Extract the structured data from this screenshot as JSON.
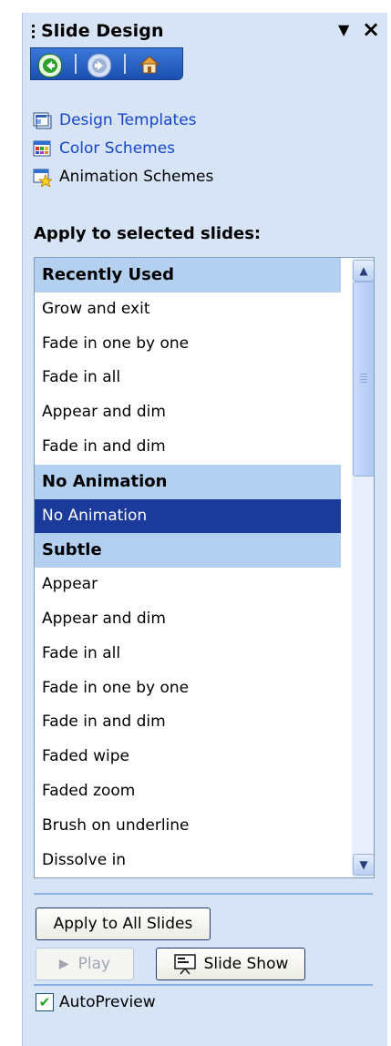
{
  "pane": {
    "title": "Slide Design",
    "dropdown_glyph": "▼",
    "close_glyph": "×"
  },
  "nav": {
    "back_icon": "back-arrow-icon",
    "forward_icon": "forward-arrow-icon",
    "home_icon": "home-icon"
  },
  "links": [
    {
      "label": "Design Templates",
      "icon": "design-templates-icon"
    },
    {
      "label": "Color Schemes",
      "icon": "color-schemes-icon"
    },
    {
      "label": "Animation Schemes",
      "icon": "animation-schemes-icon"
    }
  ],
  "apply_label": "Apply to selected slides:",
  "list": {
    "rows": [
      {
        "text": "Recently Used",
        "kind": "header"
      },
      {
        "text": "Grow and exit",
        "kind": "item"
      },
      {
        "text": "Fade in one by one",
        "kind": "item"
      },
      {
        "text": "Fade in all",
        "kind": "item"
      },
      {
        "text": "Appear and dim",
        "kind": "item"
      },
      {
        "text": "Fade in and dim",
        "kind": "item"
      },
      {
        "text": "No Animation",
        "kind": "header"
      },
      {
        "text": "No Animation",
        "kind": "selected"
      },
      {
        "text": "Subtle",
        "kind": "header"
      },
      {
        "text": "Appear",
        "kind": "item"
      },
      {
        "text": "Appear and dim",
        "kind": "item"
      },
      {
        "text": "Fade in all",
        "kind": "item"
      },
      {
        "text": "Fade in one by one",
        "kind": "item"
      },
      {
        "text": "Fade in and dim",
        "kind": "item"
      },
      {
        "text": "Faded wipe",
        "kind": "item"
      },
      {
        "text": "Faded zoom",
        "kind": "item"
      },
      {
        "text": "Brush on underline",
        "kind": "item"
      },
      {
        "text": "Dissolve in",
        "kind": "item"
      }
    ]
  },
  "buttons": {
    "apply_all": "Apply to All Slides",
    "play": "Play",
    "slide_show": "Slide Show"
  },
  "autopreview": {
    "label": "AutoPreview",
    "checked": true
  },
  "colors": {
    "pane_bg": "#d6e4f6",
    "header_row": "#b3d0f1",
    "selected_row": "#1a3a9c",
    "link": "#1646c8"
  }
}
